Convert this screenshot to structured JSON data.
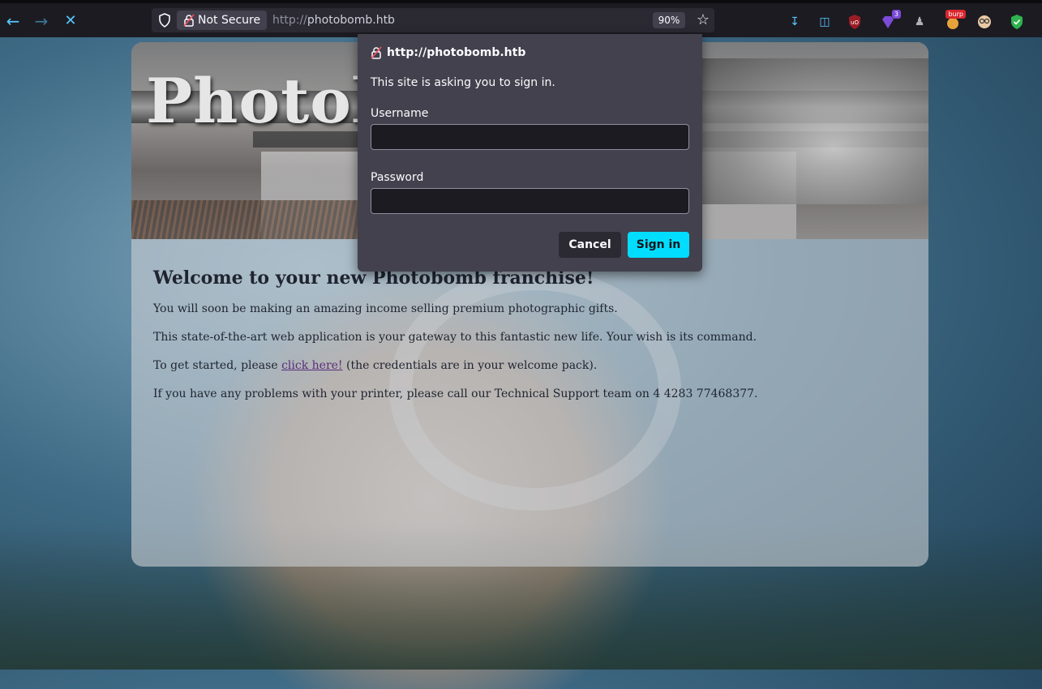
{
  "browser": {
    "security_label": "Not Secure",
    "url_scheme": "http://",
    "url_host": "photobomb.htb",
    "zoom": "90%",
    "extension_badge_count": "3",
    "extension_badge_burp": "burp"
  },
  "page": {
    "hero_title": "Photob",
    "heading": "Welcome to your new Photobomb franchise!",
    "para1": "You will soon be making an amazing income selling premium photographic gifts.",
    "para2": "This state-of-the-art web application is your gateway to this fantastic new life. Your wish is its command.",
    "para3_before": "To get started, please ",
    "para3_link": "click here!",
    "para3_after": " (the credentials are in your welcome pack).",
    "para4": "If you have any problems with your printer, please call our Technical Support team on 4 4283 77468377."
  },
  "dialog": {
    "origin": "http://photobomb.htb",
    "message": "This site is asking you to sign in.",
    "username_label": "Username",
    "username_value": "",
    "password_label": "Password",
    "password_value": "",
    "cancel_label": "Cancel",
    "signin_label": "Sign in"
  },
  "colors": {
    "accent": "#00ddff",
    "toolbar_bg": "#1c1b22",
    "dialog_bg": "#42414d",
    "link": "#5a2d7a"
  }
}
